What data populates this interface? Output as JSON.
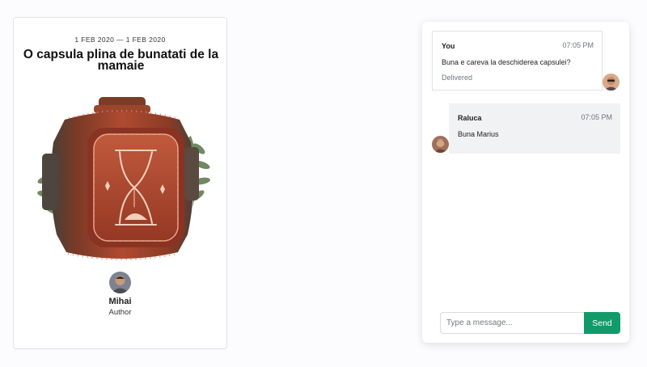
{
  "capsule": {
    "dates": "1 FEB 2020 — 1 FEB 2020",
    "title": "O capsula plina de bunatati de la mamaie",
    "illustration_icon": "hourglass-icon",
    "author": {
      "name": "Mihai",
      "role": "Author"
    }
  },
  "chat": {
    "messages": [
      {
        "sender": "You",
        "time": "07:05 PM",
        "text": "Buna e careva la deschiderea capsulei?",
        "status": "Delivered"
      },
      {
        "sender": "Raluca",
        "time": "07:05 PM",
        "text": "Buna Marius"
      }
    ],
    "input": {
      "value": "",
      "placeholder": "Type a message..."
    },
    "send_label": "Send"
  },
  "colors": {
    "accent": "#119b6a",
    "capsule_body": "#a5412b",
    "page_background": "#fcfbfd",
    "incoming_bubble": "#f1f2f4"
  }
}
